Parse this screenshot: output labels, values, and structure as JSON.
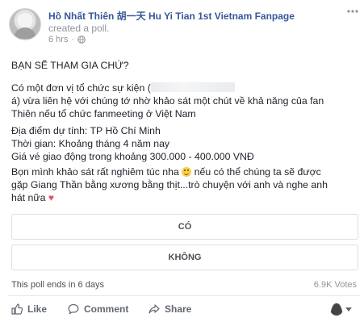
{
  "post": {
    "author": "Hồ Nhất Thiên 胡一天 Hu Yi Tian 1st Vietnam Fanpage",
    "action": "created a poll.",
    "time": "6 hrs",
    "time_sep": "·",
    "heading": "BẠN SẼ THAM GIA CHỨ?",
    "para1_line1": "Có một đơn vị tổ chức sự kiện (",
    "para1_line2": "á) vừa liên hệ với chúng tớ nhờ khảo sát một chút về khả năng của fan",
    "para1_line3": "Thiên nếu tổ chức fanmeeting ở Việt Nam",
    "location": "Địa điểm dự tính: TP Hồ Chí Minh",
    "timeline": "Thời gian: Khoảng tháng 4 năm nay",
    "price": "Giá vé giao động trong khoảng 300.000 - 400.000 VNĐ",
    "para4_a": "Bọn mình khảo sát rất nghiêm túc nha",
    "para4_b": "nếu có thể chúng ta sẽ được",
    "para4_line2": "gặp Giang Thần bằng xương bằng thịt...trò chuyện với anh và nghe anh",
    "para4_line3": "hát nữa",
    "heart": "♥"
  },
  "poll": {
    "options": [
      "CÓ",
      "KHÔNG"
    ],
    "ends": "This poll ends in 6 days",
    "votes": "6.9K Votes"
  },
  "actions": {
    "like": "Like",
    "comment": "Comment",
    "share": "Share"
  },
  "colors": {
    "link": "#365899",
    "muted": "#90949c",
    "text": "#1d2129",
    "border": "#dddfe2"
  },
  "icons": [
    "globe-icon",
    "more-options-icon",
    "like-icon",
    "comment-icon",
    "share-icon",
    "smile-emoji-icon",
    "heart-emoji-icon",
    "caret-down-icon"
  ]
}
